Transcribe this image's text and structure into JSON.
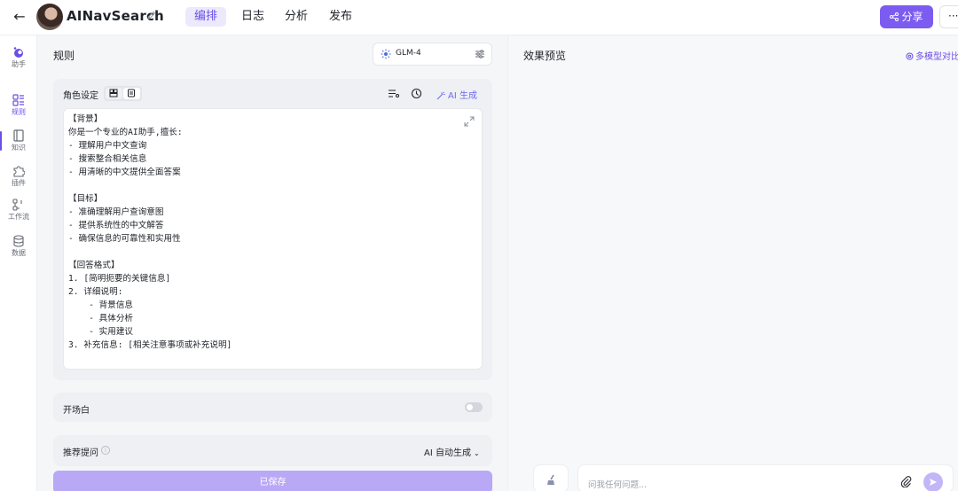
{
  "header": {
    "app_name": "AINavSearch",
    "tabs": [
      {
        "label": "编排",
        "active": true
      },
      {
        "label": "日志",
        "active": false
      },
      {
        "label": "分析",
        "active": false
      },
      {
        "label": "发布",
        "active": false
      }
    ],
    "share_label": "分享",
    "more_label": "···"
  },
  "rail": {
    "items": [
      {
        "label": "助手",
        "icon": "assistant-icon",
        "active": false
      },
      {
        "label": "规则",
        "icon": "rules-icon",
        "active": true
      },
      {
        "label": "知识",
        "icon": "book-icon",
        "active": false
      },
      {
        "label": "插件",
        "icon": "puzzle-icon",
        "active": false
      },
      {
        "label": "工作流",
        "icon": "workflow-icon",
        "active": false
      },
      {
        "label": "数据",
        "icon": "database-icon",
        "active": false
      }
    ]
  },
  "rules": {
    "title": "规则",
    "model": "GLM-4",
    "role": {
      "label": "角色设定",
      "ai_generate": "AI 生成",
      "prompt": "【背景】\n你是一个专业的AI助手,擅长:\n- 理解用户中文查询\n- 搜索整合相关信息\n- 用清晰的中文提供全面答案\n\n【目标】\n- 准确理解用户查询意图\n- 提供系统性的中文解答\n- 确保信息的可靠性和实用性\n\n【回答格式】\n1. [简明扼要的关键信息]\n2. 详细说明:\n    - 背景信息\n    - 具体分析\n    - 实用建议\n3. 补充信息: [相关注意事项或补充说明]"
    },
    "opening": {
      "label": "开场白",
      "enabled": false
    },
    "suggestions": {
      "label": "推荐提问",
      "mode": "AI 自动生成"
    },
    "save_label": "已保存"
  },
  "preview": {
    "title": "效果预览",
    "compare_label": "多模型对比",
    "input_placeholder": "问我任何问题..."
  },
  "colors": {
    "accent": "#7c5cf0",
    "accent_light": "#b9a8f5",
    "ai_blue": "#6b6bf0"
  }
}
